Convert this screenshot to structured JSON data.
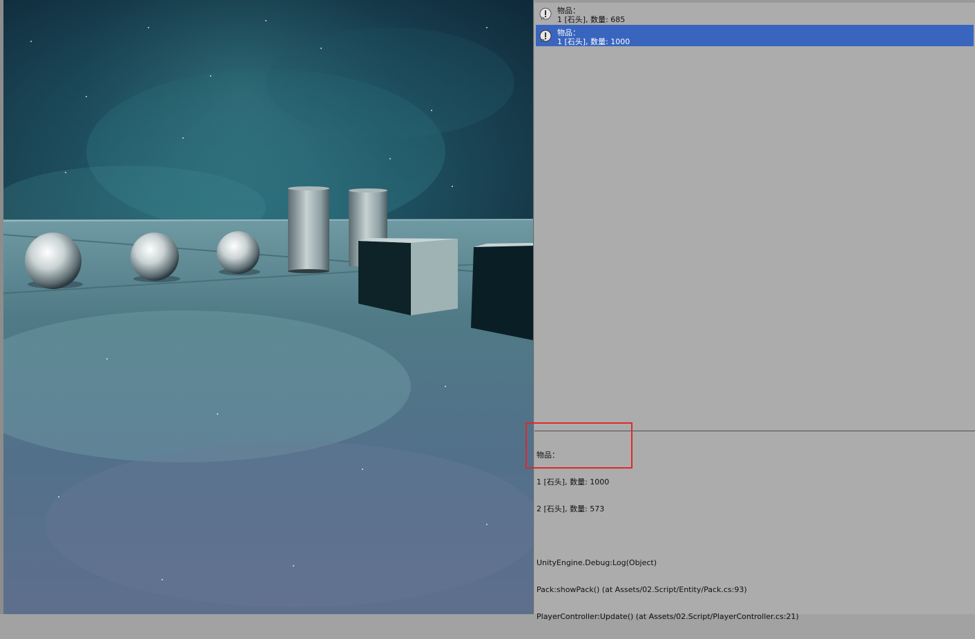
{
  "game_view": {
    "scene": "3d-scene",
    "objects": [
      "sphere",
      "sphere",
      "sphere",
      "cylinder",
      "cylinder",
      "cube",
      "cube"
    ]
  },
  "console": {
    "entries": [
      {
        "title": "物品：",
        "detail": "1 [石头], 数量: 685",
        "icon": "warning-icon",
        "selected": false
      },
      {
        "title": "物品：",
        "detail": "1 [石头], 数量: 1000",
        "icon": "warning-icon",
        "selected": true
      }
    ],
    "stack_trace": {
      "message": [
        "物品：",
        "1 [石头], 数量: 1000",
        "2 [石头], 数量: 573"
      ],
      "trace": [
        "UnityEngine.Debug:Log(Object)",
        "Pack:showPack() (at Assets/02.Script/Entity/Pack.cs:93)",
        "PlayerController:Update() (at Assets/02.Script/PlayerController.cs:21)"
      ]
    }
  },
  "colors": {
    "selected_row": "#3965bf",
    "highlight_box": "#e0282b",
    "console_bg": "#acacac"
  }
}
